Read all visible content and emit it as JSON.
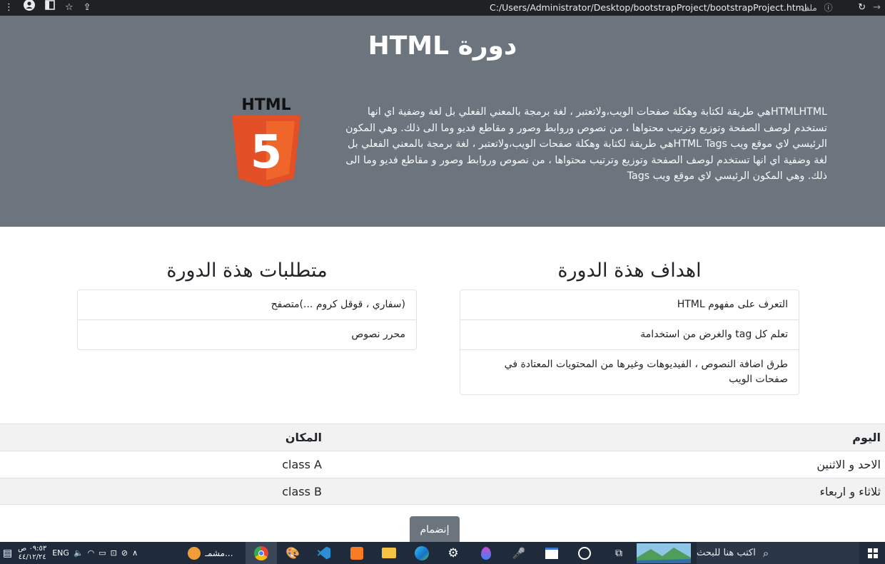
{
  "browser": {
    "url": "C:/Users/Administrator/Desktop/bootstrapProject/bootstrapProject.html",
    "file_label": "ملف"
  },
  "hero": {
    "title": "دورة HTML",
    "logo_text": "HTML",
    "logo_number": "5",
    "paragraph": "HTMLHTMLهي طريقة لكتابة وهكلة صفحات الويب،ولاتعتبر ، لغة برمجة بالمعني الفعلي بل لغة وضفية اي انها تستخدم لوصف الصفحة وتوزيع وترتيب محتواها ، من نصوص وروابط وصور و مقاطع فديو وما الى ذلك. وهي المكون الرئيسي لاي موقع ويب HTML Tagsهي طريقة لكتابة وهكلة صفحات الويب،ولاتعتبر ، لغة برمجة بالمعني الفعلي بل لغة وضفية اي انها تستخدم لوصف الصفحة وتوزيع وترتيب محتواها ، من نصوص وروابط وصور و مقاطع فديو وما الى ذلك. وهي المكون الرئيسي لاي موقع ويب Tags"
  },
  "goals": {
    "title": "اهداف هذة الدورة",
    "items": [
      "التعرف على مفهوم HTML",
      "تعلم كل tag والغرض من استخدامة",
      "طرق اضافة النصوص ، الفيديوهات وغيرها من المحتويات المعتادة في صفحات الويب"
    ]
  },
  "requirements": {
    "title": "متطلبات هذة الدورة",
    "items": [
      "(سفاري ، قوقل كروم ...)متصفح",
      "محرر نصوص"
    ]
  },
  "schedule": {
    "headers": {
      "day": "اليوم",
      "place": "المكان"
    },
    "rows": [
      {
        "day": "الاحد و الاثنين",
        "place": "class A"
      },
      {
        "day": "ثلاثاء و اربعاء",
        "place": "class B"
      }
    ]
  },
  "join_button": "إنضمام",
  "taskbar": {
    "search_placeholder": "اكتب هنا للبحث",
    "lang": "ENG",
    "time": "٠٩:٥٣ ص",
    "date": "٤٤/١٢/٢٤",
    "app_label": "مشمـ..."
  },
  "colors": {
    "hero_bg": "#6c757d",
    "button_bg": "#6c757d",
    "html5_orange": "#e34f26",
    "html5_light": "#ef652a",
    "taskbar_bg": "#1f2a3a"
  }
}
